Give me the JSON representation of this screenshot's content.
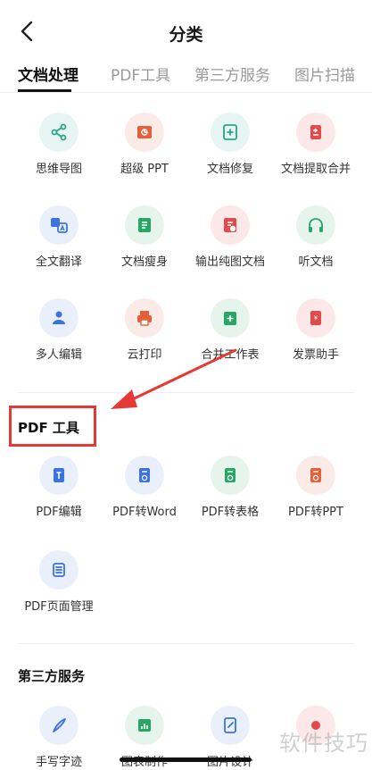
{
  "nav": {
    "title": "分类"
  },
  "tabs": [
    {
      "label": "文档处理",
      "active": true
    },
    {
      "label": "PDF工具",
      "active": false
    },
    {
      "label": "第三方服务",
      "active": false
    },
    {
      "label": "图片扫描",
      "active": false
    }
  ],
  "sections": {
    "doc": {
      "items": [
        {
          "label": "思维导图",
          "icon": "mind-map-icon",
          "bg": "#e6f5f2",
          "color": "#2aa58a"
        },
        {
          "label": "超级 PPT",
          "icon": "ppt-icon",
          "bg": "#fbebe6",
          "color": "#e5603a"
        },
        {
          "label": "文档修复",
          "icon": "doc-repair-icon",
          "bg": "#e6f5f2",
          "color": "#2aa58a"
        },
        {
          "label": "文档提取合并",
          "icon": "doc-merge-icon",
          "bg": "#fce8e8",
          "color": "#e14b4b"
        },
        {
          "label": "全文翻译",
          "icon": "translate-icon",
          "bg": "#e9effb",
          "color": "#3b73e0"
        },
        {
          "label": "文档瘦身",
          "icon": "doc-slim-icon",
          "bg": "#e6f5ec",
          "color": "#2aa568"
        },
        {
          "label": "输出纯图文档",
          "icon": "image-doc-icon",
          "bg": "#fce8e8",
          "color": "#e14b4b"
        },
        {
          "label": "听文档",
          "icon": "headphones-icon",
          "bg": "#e6f5ec",
          "color": "#2aa568"
        },
        {
          "label": "多人编辑",
          "icon": "multi-edit-icon",
          "bg": "#e9effb",
          "color": "#3b73e0"
        },
        {
          "label": "云打印",
          "icon": "printer-icon",
          "bg": "#fbebe6",
          "color": "#e5603a"
        },
        {
          "label": "合并工作表",
          "icon": "sheet-merge-icon",
          "bg": "#e6f5ec",
          "color": "#2aa568"
        },
        {
          "label": "发票助手",
          "icon": "invoice-icon",
          "bg": "#fce8e8",
          "color": "#e14b4b"
        }
      ]
    },
    "pdf": {
      "title": "PDF 工具",
      "items": [
        {
          "label": "PDF编辑",
          "icon": "pdf-edit-icon",
          "bg": "#e9effb",
          "color": "#3b73e0"
        },
        {
          "label": "PDF转Word",
          "icon": "pdf-to-word-icon",
          "bg": "#e9effb",
          "color": "#3b73e0"
        },
        {
          "label": "PDF转表格",
          "icon": "pdf-to-excel-icon",
          "bg": "#e6f5ec",
          "color": "#2aa568"
        },
        {
          "label": "PDF转PPT",
          "icon": "pdf-to-ppt-icon",
          "bg": "#fbebe6",
          "color": "#e5603a"
        },
        {
          "label": "PDF页面管理",
          "icon": "pdf-pages-icon",
          "bg": "#e9effb",
          "color": "#3b73e0"
        }
      ]
    },
    "third": {
      "title": "第三方服务",
      "items": [
        {
          "label": "手写字迹",
          "icon": "handwriting-icon",
          "bg": "#e9effb",
          "color": "#3b73e0"
        },
        {
          "label": "图表制作",
          "icon": "chart-make-icon",
          "bg": "#e6f5ec",
          "color": "#2aa568"
        },
        {
          "label": "图片设计",
          "icon": "image-design-icon",
          "bg": "#e9effb",
          "color": "#3b73e0"
        },
        {
          "label": "",
          "icon": "service-icon",
          "bg": "#fce8e8",
          "color": "#e14b4b"
        }
      ]
    }
  },
  "watermark": "软件技巧"
}
